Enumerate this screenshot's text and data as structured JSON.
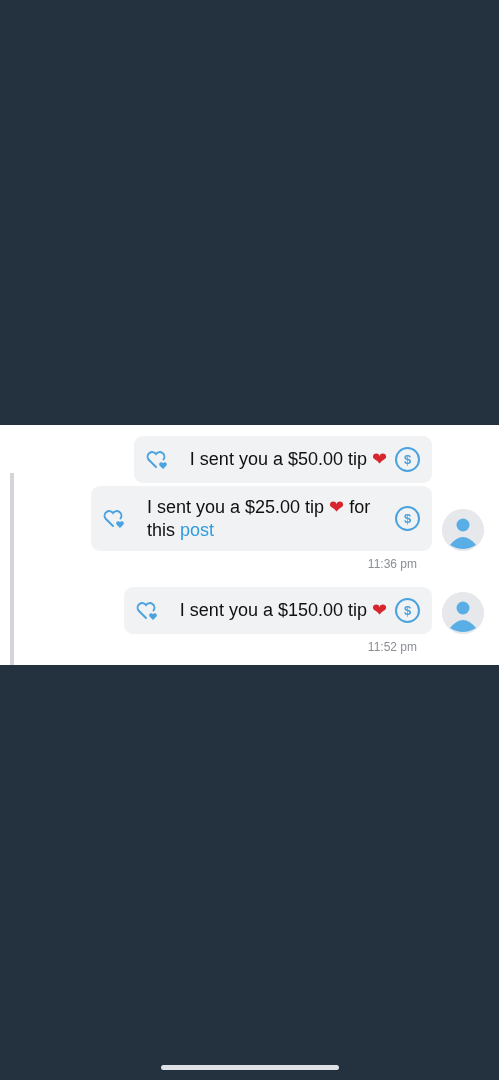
{
  "messages": [
    {
      "avatar": false,
      "coin_symbol": "$",
      "text": "I sent you a $50.00 tip",
      "emoji": "❤"
    },
    {
      "avatar": true,
      "coin_symbol": "$",
      "text": "I sent you a $25.00 tip",
      "emoji": "❤",
      "text_after": "for this",
      "link": "post",
      "time": "11:36 pm"
    },
    {
      "avatar": true,
      "coin_symbol": "$",
      "text": "I sent you a $150.00 tip",
      "emoji": "❤",
      "time": "11:52 pm"
    }
  ]
}
